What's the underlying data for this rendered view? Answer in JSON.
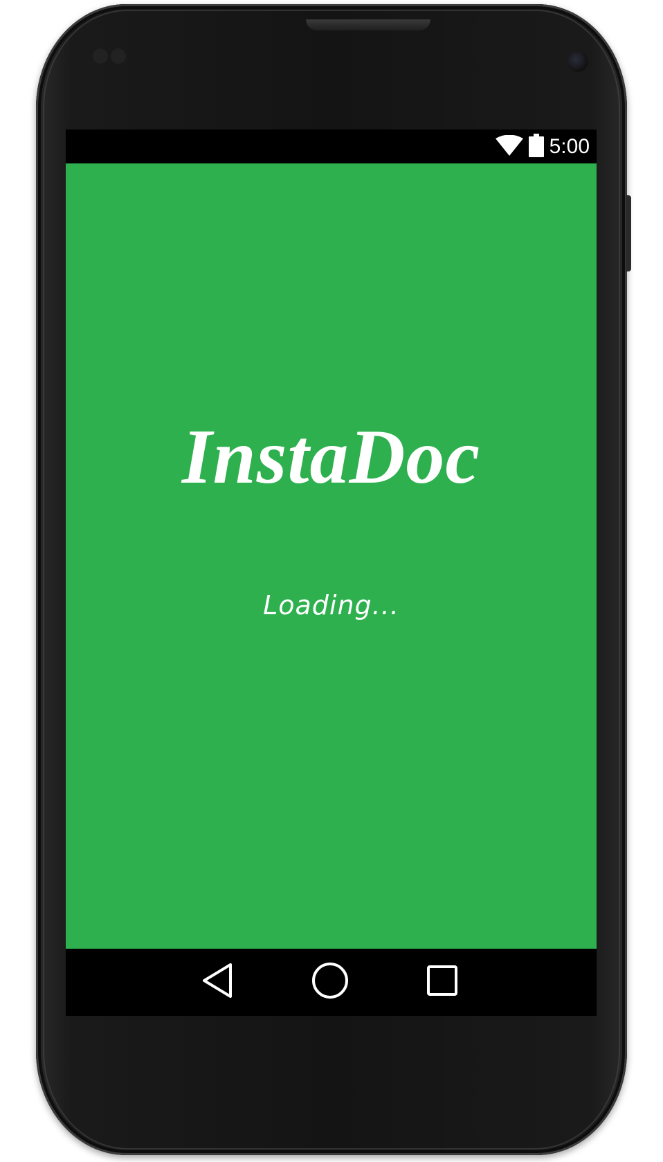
{
  "status_bar": {
    "time": "5:00",
    "wifi_icon": "wifi-icon",
    "battery_icon": "battery-icon"
  },
  "app": {
    "title": "InstaDoc",
    "loading_text": "Loading...",
    "background_color": "#2eb04e",
    "text_color": "#ffffff"
  },
  "nav_bar": {
    "back_icon": "back-triangle-icon",
    "home_icon": "home-circle-icon",
    "recents_icon": "recents-square-icon"
  }
}
